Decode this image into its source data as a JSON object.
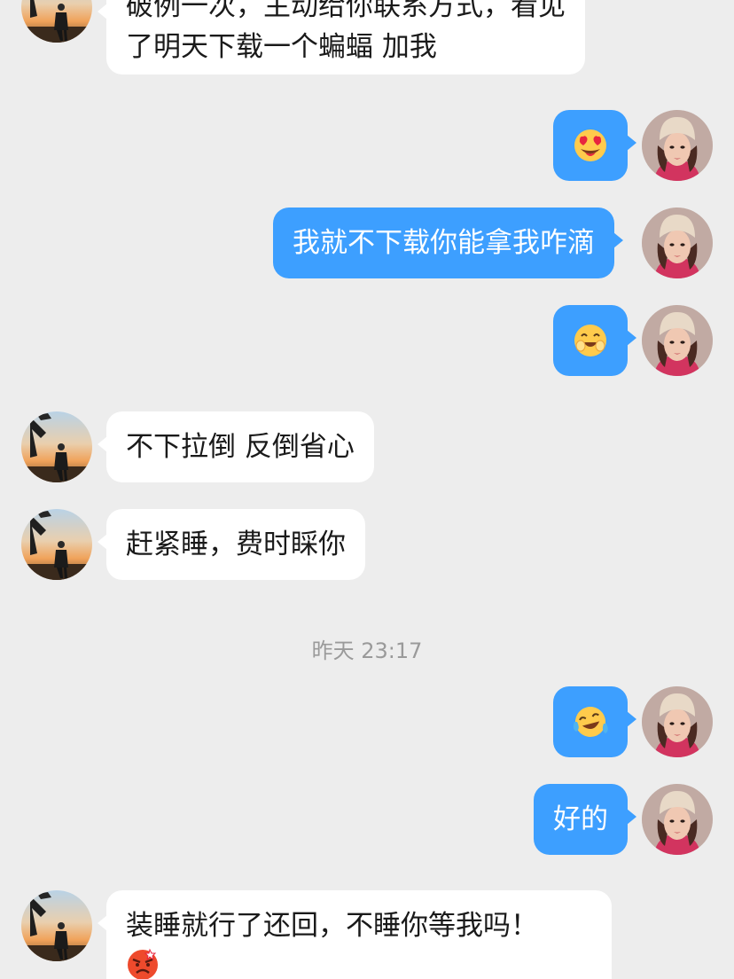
{
  "messages": {
    "m1_line1": "破例一次，主动给你联系方式，看见",
    "m1_line2": "了明天下载一个蝙蝠 加我",
    "m3_text": "我就不下载你能拿我咋滴",
    "m5_text": "不下拉倒 反倒省心",
    "m6_text": "赶紧睡，费时睬你",
    "timestamp": "昨天 23:17",
    "m8_text": "好的",
    "m9_line1": "装睡就行了还回，不睡你等我吗！"
  },
  "icons": {
    "m2": "heart-eyes-emoji",
    "m4": "blushing-smile-emoji",
    "m7": "tears-of-joy-emoji",
    "m9": "angry-face-emoji"
  },
  "colors": {
    "background": "#ededed",
    "incoming_bubble": "#ffffff",
    "outgoing_bubble": "#3d9fff",
    "timestamp": "#9a9a9a"
  }
}
